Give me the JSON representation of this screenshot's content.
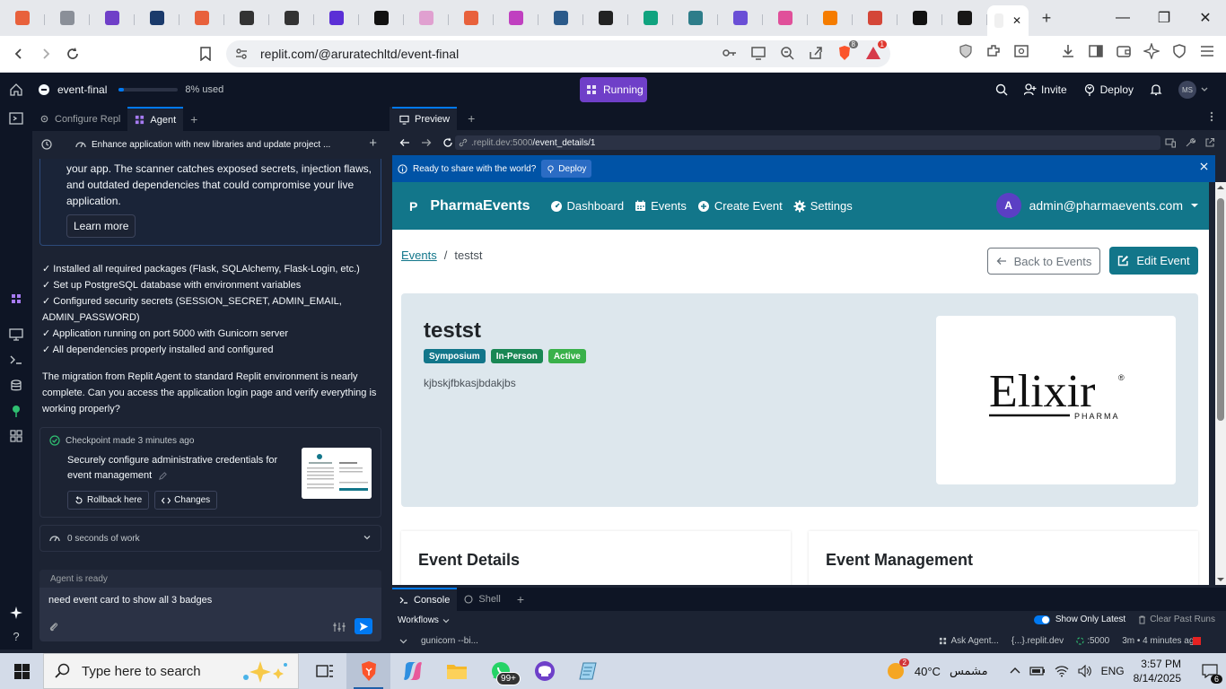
{
  "browser": {
    "url": "replit.com/@aruratechltd/event-final",
    "tab_close": "✕",
    "new_tab": "+",
    "win_min": "—",
    "win_max": "❐",
    "win_close": "✕",
    "brave_badge": "8",
    "triangle_badge": "1",
    "tab_favicons": [
      "#e8613c",
      "#8a8f98",
      "#6f3fc8",
      "#1a3a6b",
      "#e8613c",
      "#333333",
      "#333333",
      "#5b2fd6",
      "#111111",
      "#e0a0d0",
      "#e8613c",
      "#c040c0",
      "#2b5a8a",
      "#222222",
      "#10a37f",
      "#2e7d8a",
      "#6a4fd6",
      "#e0509a",
      "#f57c00",
      "#d44638",
      "#111111",
      "#181717",
      "#f0f0f0"
    ]
  },
  "replit": {
    "repl_name": "event-final",
    "usage": "8% used",
    "usage_fraction": 0.08,
    "run_status": "Running",
    "invite": "Invite",
    "deploy": "Deploy",
    "avatar": "MS",
    "accent": "#0079f2",
    "run_color": "#6f3fc8"
  },
  "agent": {
    "tabs": [
      "Configure Repl",
      "Agent"
    ],
    "add_tab": "+",
    "task_title": "Enhance application with new libraries and update project ...",
    "new_chat": "+",
    "scanner_text": "your app. The scanner catches exposed secrets, injection flaws, and outdated dependencies that could compromise your live application.",
    "learn_more": "Learn more",
    "steps": [
      "✓ Installed all required packages (Flask, SQLAlchemy, Flask-Login, etc.)",
      "✓ Set up PostgreSQL database with environment variables",
      "✓ Configured security secrets (SESSION_SECRET, ADMIN_EMAIL, ADMIN_PASSWORD)",
      "✓ Application running on port 5000 with Gunicorn server",
      "✓ All dependencies properly installed and configured"
    ],
    "migration_text": "The migration from Replit Agent to standard Replit environment is nearly complete. Can you access the application login page and verify everything is working properly?",
    "checkpoint_head": "Checkpoint made 3 minutes ago",
    "checkpoint_desc": "Securely configure administrative credentials for event management",
    "rollback": "Rollback here",
    "changes": "Changes",
    "work": "0 seconds of work",
    "ready": "Agent is ready",
    "input_text": "need event card to show all 3 badges"
  },
  "preview": {
    "tab": "Preview",
    "add_tab": "+",
    "url_host": ".replit.dev:5000",
    "url_path": "/event_details/1",
    "banner_text": "Ready to share with the world?",
    "banner_btn": "Deploy",
    "banner_close": "✕"
  },
  "app": {
    "brand_letter": "P",
    "brand": "PharmaEvents",
    "nav": [
      "Dashboard",
      "Events",
      "Create Event",
      "Settings"
    ],
    "user_initial": "A",
    "user_email": "admin@pharmaevents.com",
    "breadcrumb_link": "Events",
    "breadcrumb_sep": "/",
    "breadcrumb_current": "testst",
    "back": "Back to Events",
    "edit": "Edit Event",
    "event_title": "testst",
    "badges": [
      {
        "label": "Symposium",
        "color": "#12768a"
      },
      {
        "label": "In-Person",
        "color": "#198754"
      },
      {
        "label": "Active",
        "color": "#3ab14a"
      }
    ],
    "description": "kjbskjfbkasjbdakjbs",
    "logo_text": "Elixir",
    "logo_sub": "PHARMA",
    "logo_reg": "®",
    "card_details": "Event Details",
    "card_mgmt": "Event Management",
    "primary_color": "#12768a",
    "hero_color": "#dde7ed"
  },
  "console": {
    "tabs": [
      "Console",
      "Shell"
    ],
    "add_tab": "+",
    "workflows": "Workflows",
    "show_latest": "Show Only Latest",
    "clear": "Clear Past Runs",
    "workflow_name": "gunicorn --bi...",
    "ask_agent": "Ask Agent...",
    "domain": "{...}.replit.dev",
    "port": ":5000",
    "time": "3m • 4 minutes ago"
  },
  "taskbar": {
    "search_placeholder": "Type here to search",
    "temperature": "40°C",
    "weather": "مشمس",
    "weather_badge": "2",
    "whatsapp_badge": "99+",
    "lang": "ENG",
    "time": "3:57 PM",
    "date": "8/14/2025",
    "notif_badge": "6"
  }
}
